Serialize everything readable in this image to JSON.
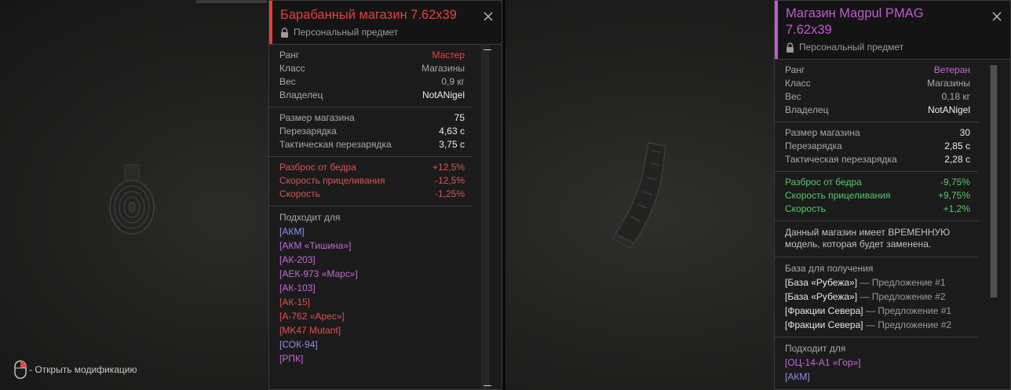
{
  "hint": {
    "text": "- Открыть модификацию"
  },
  "left_item": {
    "title": "Барабанный магазин 7.62x39",
    "subtitle": "Персональный предмет",
    "accent": "#e2403f",
    "info": [
      {
        "label": "Ранг",
        "value": "Мастер",
        "color": "#e34848"
      },
      {
        "label": "Класс",
        "value": "Магазины",
        "color": "#a8a8a8"
      },
      {
        "label": "Вес",
        "value": "0,9 кг",
        "color": "#a8a8a8"
      },
      {
        "label": "Владелец",
        "value": "NotANigel",
        "color": "#ececec"
      }
    ],
    "stats": [
      {
        "label": "Размер магазина",
        "value": "75"
      },
      {
        "label": "Перезарядка",
        "value": "4,63 с"
      },
      {
        "label": "Тактическая перезарядка",
        "value": "3,75 с"
      }
    ],
    "modifiers": [
      {
        "label": "Разброс от бедра",
        "value": "+12,5%",
        "color": "#d85454"
      },
      {
        "label": "Скорость прицеливания",
        "value": "-12,5%",
        "color": "#d85454"
      },
      {
        "label": "Скорость",
        "value": "-1,25%",
        "color": "#d85454"
      }
    ],
    "fits_title": "Подходит для",
    "fits": [
      {
        "name": "[АКМ]",
        "color": "#8f8ff0"
      },
      {
        "name": "[АКМ «Тишина»]",
        "color": "#c468d8"
      },
      {
        "name": "[АК-203]",
        "color": "#c468d8"
      },
      {
        "name": "[АЕК-973 «Марс»]",
        "color": "#c468d8"
      },
      {
        "name": "[АК-103]",
        "color": "#c468d8"
      },
      {
        "name": "[АК-15]",
        "color": "#e05050"
      },
      {
        "name": "[А-762 «Арес»]",
        "color": "#e05050"
      },
      {
        "name": "[MK47 Mutant]",
        "color": "#e05050"
      },
      {
        "name": "[СОК-94]",
        "color": "#8f8ff0"
      },
      {
        "name": "[РПК]",
        "color": "#c468d8"
      }
    ]
  },
  "right_item": {
    "title": "Магазин Magpul PMAG 7.62x39",
    "subtitle": "Персональный предмет",
    "accent": "#c05bd0",
    "info": [
      {
        "label": "Ранг",
        "value": "Ветеран",
        "color": "#c468d8"
      },
      {
        "label": "Класс",
        "value": "Магазины",
        "color": "#a8a8a8"
      },
      {
        "label": "Вес",
        "value": "0,18 кг",
        "color": "#a8a8a8"
      },
      {
        "label": "Владелец",
        "value": "NotANigel",
        "color": "#ececec"
      }
    ],
    "stats": [
      {
        "label": "Размер магазина",
        "value": "30"
      },
      {
        "label": "Перезарядка",
        "value": "2,85 с"
      },
      {
        "label": "Тактическая перезарядка",
        "value": "2,28 с"
      }
    ],
    "modifiers": [
      {
        "label": "Разброс от бедра",
        "value": "-9,75%",
        "color": "#57c86a"
      },
      {
        "label": "Скорость прицеливания",
        "value": "+9,75%",
        "color": "#57c86a"
      },
      {
        "label": "Скорость",
        "value": "+1,2%",
        "color": "#57c86a"
      }
    ],
    "note": "Данный магазин имеет ВРЕМЕННУЮ модель, которая будет заменена.",
    "base_title": "База для получения",
    "bases": [
      {
        "name": "[База «Рубежа»]",
        "offer": " — Предложение #1"
      },
      {
        "name": "[База «Рубежа»]",
        "offer": " — Предложение #2"
      },
      {
        "name": "[Фракции Севера]",
        "offer": " — Предложение #1"
      },
      {
        "name": "[Фракции Севера]",
        "offer": " — Предложение #2"
      }
    ],
    "fits_title": "Подходит для",
    "fits": [
      {
        "name": "[ОЦ-14-А1 «Гор»]",
        "color": "#c468d8"
      },
      {
        "name": "[АКМ]",
        "color": "#8f8ff0"
      }
    ]
  },
  "icons": {
    "lock": "lock-icon",
    "close": "close-icon",
    "mouse": "mouse-icon"
  }
}
